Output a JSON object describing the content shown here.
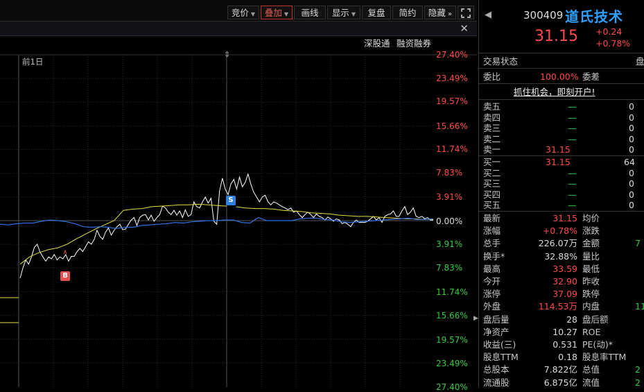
{
  "toolbar": {
    "buttons": [
      {
        "label": "竞价",
        "dropdown": true
      },
      {
        "label": "叠加",
        "dropdown": true,
        "active": true
      },
      {
        "label": "画线",
        "dropdown": false
      },
      {
        "label": "显示",
        "dropdown": true
      },
      {
        "label": "复盘",
        "dropdown": false
      },
      {
        "label": "简约",
        "dropdown": false
      },
      {
        "label": "隐藏",
        "dropdown": false
      }
    ],
    "more_icon": "»",
    "fullscreen_icon": "⛶"
  },
  "subbar": {
    "links": [
      "深股通",
      "融资融券"
    ],
    "close": "✕"
  },
  "chart": {
    "prev_day_label": "前1日",
    "drag_handle": "⇕",
    "markers": [
      {
        "label": "S"
      },
      {
        "label": "B"
      }
    ],
    "pct_labels_top": [
      "27.40%",
      "23.49%",
      "19.57%",
      "15.66%",
      "11.74%",
      "7.83%",
      "3.91%"
    ],
    "pct_zero": "0.00%",
    "pct_labels_bottom": [
      "3.91%",
      "7.83%",
      "11.74%",
      "15.66%",
      "19.57%",
      "23.49%",
      "27.40%"
    ]
  },
  "chart_data": {
    "type": "line",
    "title": "",
    "ylim": [
      -27.4,
      27.4
    ],
    "series": [
      {
        "values": [
          -9.5,
          -7.8,
          -6.5,
          -7.2,
          -6.0,
          -4.4,
          -3.9,
          -5.2,
          -6.0,
          -6.7,
          -6.0,
          -6.3,
          -5.6,
          -6.5,
          -6.0,
          -6.3,
          -5.6,
          -6.7,
          -5.9,
          -5.9,
          -5.1,
          -4.6,
          -5.1,
          -4.3,
          -3.5,
          -3.9,
          -3.1,
          -1.6,
          -2.6,
          -3.1,
          -1.9,
          -1.2,
          -2.4,
          -1.6,
          -1.0,
          -0.6,
          -1.5,
          -1.4,
          -0.6,
          0.1,
          0.5,
          -0.8,
          0.5,
          0.9,
          1.0,
          0.1,
          0.9,
          -0.1,
          0.5,
          1.0,
          2.4,
          2.1,
          1.4,
          1.0,
          1.7,
          0.9,
          1.6,
          0.5,
          1.8,
          0.7,
          1.0,
          3.1,
          2.3,
          2.1,
          3.1,
          3.9,
          2.9,
          3.7,
          -0.1,
          -0.6,
          4.9,
          7.0,
          5.2,
          4.3,
          6.1,
          6.8,
          5.2,
          7.2,
          5.6,
          6.3,
          7.7,
          6.0,
          4.7,
          3.9,
          3.1,
          3.9,
          4.2,
          3.1,
          2.6,
          3.1,
          2.9,
          2.6,
          2.3,
          2.1,
          1.8,
          2.1,
          1.4,
          1.6,
          1.0,
          0.5,
          1.0,
          1.4,
          1.0,
          0.5,
          1.1,
          0.7,
          0.5,
          0.1,
          0.6,
          0.3,
          -0.1,
          0.3,
          0.1,
          -0.5,
          -0.3,
          -0.6,
          -1.0,
          -0.3,
          0.1,
          -0.3,
          -0.3,
          -0.3,
          -0.1,
          0.3,
          0.7,
          0.1,
          0.5,
          -0.3,
          0.7,
          1.0,
          1.1,
          1.6,
          0.7,
          0.7,
          1.6,
          2.3,
          1.0,
          1.4,
          2.1,
          0.7,
          0.5,
          0.7,
          0.3,
          0.5,
          0.1,
          0.1
        ]
      },
      {
        "values": [
          -7.2,
          -6.0,
          -5.3,
          -4.8,
          -4.5,
          -3.9,
          -3.0,
          -2.2,
          -1.4,
          -0.7,
          0.0,
          1.7,
          1.9,
          2.0,
          2.3,
          2.4,
          2.5,
          2.6,
          2.6,
          2.7,
          2.6,
          2.5,
          2.4,
          2.3,
          2.1,
          2.0,
          2.0,
          1.9,
          1.7,
          1.6,
          1.5,
          1.3,
          1.2,
          1.1,
          0.9,
          0.8,
          0.7,
          0.7,
          0.6,
          0.5,
          0.4,
          0.3,
          0.3,
          0.2,
          0.2
        ]
      },
      {
        "values": [
          -0.6,
          -0.7,
          -0.5,
          -0.4,
          -0.4,
          -0.1,
          0.1,
          0.0,
          -0.2,
          -0.5,
          -1.0,
          -1.1,
          -1.0,
          -1.1,
          -1.3,
          -1.1,
          -1.1,
          -0.8,
          -0.7,
          -0.6,
          -0.5,
          -0.3,
          -0.4,
          -0.2,
          -0.1,
          0.0,
          0.0,
          0.1,
          0.1,
          -0.3,
          -0.4,
          0.5,
          0.0,
          0.0,
          0.0,
          0.0,
          0.3,
          0.4,
          0.4,
          0.2,
          0.1,
          -0.2,
          -0.3,
          -0.2,
          -0.1,
          0.0,
          0.1,
          0.2,
          0.3,
          0.4,
          0.2,
          0.2,
          0.3
        ]
      }
    ]
  },
  "quote": {
    "code": "300409",
    "name": "道氏技术",
    "price": "31.15",
    "change": "+0.24",
    "change_pct": "+0.78%",
    "back_icon": "◀"
  },
  "panel": {
    "trade_status_label": "交易状态",
    "trade_status_value": "盘",
    "weibi_label": "委比",
    "weibi_value": "100.00%",
    "weicha_label": "委差",
    "open_account": "抓住机会，即刻开户!",
    "asks": [
      {
        "label": "卖五",
        "price": "—",
        "vol": "0"
      },
      {
        "label": "卖四",
        "price": "—",
        "vol": "0"
      },
      {
        "label": "卖三",
        "price": "—",
        "vol": "0"
      },
      {
        "label": "卖二",
        "price": "—",
        "vol": "0"
      },
      {
        "label": "卖一",
        "price": "31.15",
        "vol": "0"
      }
    ],
    "bids": [
      {
        "label": "买一",
        "price": "31.15",
        "vol": "64"
      },
      {
        "label": "买二",
        "price": "—",
        "vol": "0"
      },
      {
        "label": "买三",
        "price": "—",
        "vol": "0"
      },
      {
        "label": "买四",
        "price": "—",
        "vol": "0"
      },
      {
        "label": "买五",
        "price": "—",
        "vol": "0"
      }
    ],
    "stats": [
      {
        "l": "最新",
        "v": "31.15",
        "vc": "red",
        "r": "均价",
        "rv": ""
      },
      {
        "l": "涨幅",
        "v": "+0.78%",
        "vc": "red",
        "r": "涨跌",
        "rv": ""
      },
      {
        "l": "总手",
        "v": "226.07万",
        "vc": "wht",
        "r": "金额",
        "rv": "7"
      },
      {
        "l": "换手*",
        "v": "32.88%",
        "vc": "wht",
        "r": "量比",
        "rv": ""
      },
      {
        "l": "最高",
        "v": "33.59",
        "vc": "red",
        "r": "最低",
        "rv": ""
      },
      {
        "l": "今开",
        "v": "32.90",
        "vc": "red",
        "r": "昨收",
        "rv": ""
      },
      {
        "l": "涨停",
        "v": "37.09",
        "vc": "red",
        "r": "跌停",
        "rv": ""
      },
      {
        "l": "外盘",
        "v": "114.53万",
        "vc": "red",
        "r": "内盘",
        "rv": "11"
      },
      {
        "l": "盘后量",
        "v": "28",
        "vc": "wht",
        "r": "盘后额",
        "rv": ""
      },
      {
        "l": "净资产",
        "v": "10.27",
        "vc": "wht",
        "r": "ROE",
        "rv": ""
      },
      {
        "l": "收益(三)",
        "v": "0.531",
        "vc": "wht",
        "r": "PE(动)*",
        "rv": ""
      },
      {
        "l": "股息TTM",
        "v": "0.18",
        "vc": "wht",
        "r": "股息率TTM",
        "rv": ""
      },
      {
        "l": "总股本",
        "v": "7.822亿",
        "vc": "wht",
        "r": "总值",
        "rv": "2"
      },
      {
        "l": "流通股",
        "v": "6.875亿",
        "vc": "wht",
        "r": "流值",
        "rv": "2"
      }
    ]
  },
  "colors": {
    "up": "#ff4a4a",
    "down": "#2ecc40",
    "price_line": "#ffffff",
    "avg_line": "#e0e040",
    "index_line": "#2f6fe0",
    "grid": "#2a2a2a"
  }
}
